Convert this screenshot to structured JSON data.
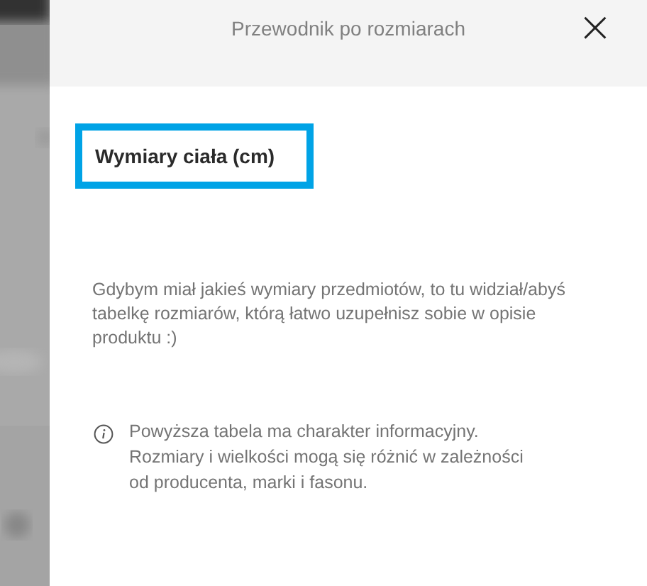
{
  "dialog": {
    "title": "Przewodnik po rozmiarach",
    "close": "×"
  },
  "section": {
    "heading": "Wymiary ciała (cm)",
    "focused": true
  },
  "empty_message": "Gdybym miał jakieś wymiary przedmiotów, to tu widział/abyś tabelkę rozmiarów, którą łatwo uzupełnisz sobie w opisie produktu :)",
  "info_note": "Powyższa tabela ma charakter informacyjny. Rozmiary i wielkości mogą się różnić w zależności od producenta, marki i fasonu."
}
